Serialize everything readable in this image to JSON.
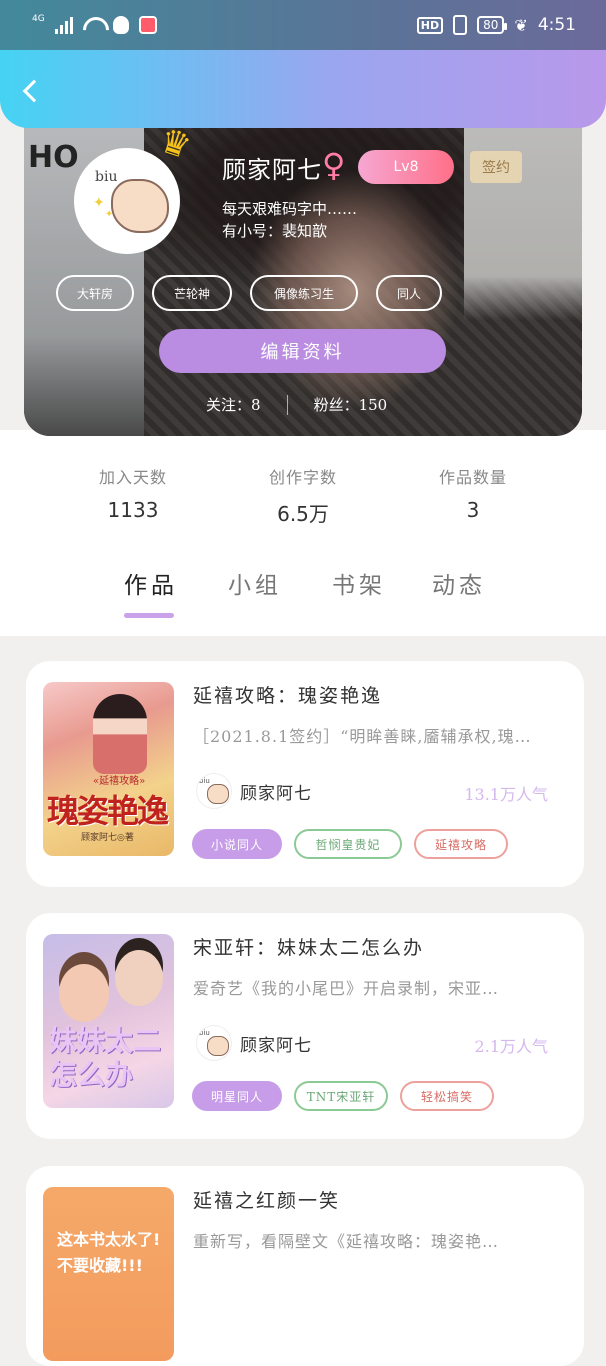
{
  "status_bar": {
    "network": "4G",
    "hd": "HD",
    "battery": "80",
    "time": "4:51"
  },
  "profile": {
    "wall_text": "HO",
    "avatar_text": "biu",
    "nickname": "顾家阿七",
    "gender_symbol": "♀",
    "level": "Lv8",
    "sign_label": "签约",
    "bio_lines": [
      "每天艰难码字中……",
      "有小号：裴知歆"
    ],
    "tags": [
      "大轩房",
      "芒轮神",
      "偶像练习生",
      "同人"
    ],
    "edit_button": "编辑资料",
    "following_label": "关注：",
    "following": "8",
    "fans_label": "粉丝：",
    "fans": "150"
  },
  "stats": [
    {
      "label": "加入天数",
      "value": "1133"
    },
    {
      "label": "创作字数",
      "value": "6.5万"
    },
    {
      "label": "作品数量",
      "value": "3"
    }
  ],
  "tabs": [
    "作品",
    "小组",
    "书架",
    "动态"
  ],
  "active_tab": "作品",
  "works": [
    {
      "title": "延禧攻略：瑰姿艳逸",
      "desc": "［2021.8.1签约］“明眸善睐,靥辅承权,瑰…",
      "cover_title": "瑰姿艳逸",
      "cover_sub": "«延禧攻略»",
      "cover_author": "顾家阿七◎著",
      "author": "顾家阿七",
      "popularity": "13.1万人气",
      "chips": [
        "小说同人",
        "哲悯皇贵妃",
        "延禧攻略"
      ]
    },
    {
      "title": "宋亚轩：妹妹太二怎么办",
      "desc": "爱奇艺《我的小尾巴》开启录制，宋亚…",
      "cover_title": "妹妹太二怎么办",
      "author": "顾家阿七",
      "popularity": "2.1万人气",
      "chips": [
        "明星同人",
        "TNT宋亚轩",
        "轻松搞笑"
      ]
    },
    {
      "title": "延禧之红颜一笑",
      "desc": "重新写，看隔壁文《延禧攻略：瑰姿艳…",
      "cover_title": "这本书太水了!\n不要收藏!!!"
    }
  ]
}
